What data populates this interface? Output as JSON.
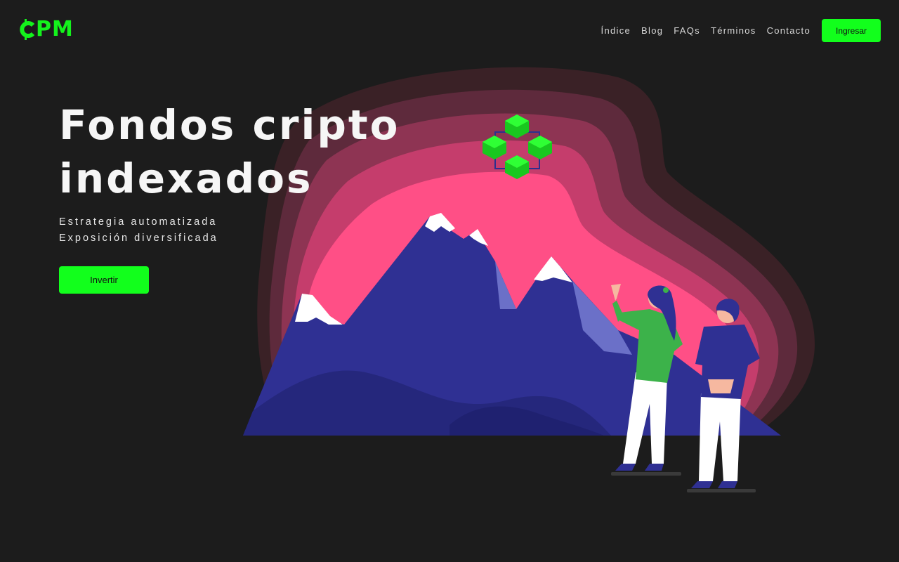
{
  "brand": {
    "logo_text": "CPM",
    "accent_color": "#12ff1c"
  },
  "nav": {
    "links": [
      "Índice",
      "Blog",
      "FAQs",
      "Términos",
      "Contacto"
    ],
    "login_label": "Ingresar"
  },
  "hero": {
    "title_line1": "Fondos cripto",
    "title_line2": "indexados",
    "subtitle_line1": "Estrategia automatizada",
    "subtitle_line2": "Exposición diversificada",
    "cta_label": "Invertir"
  },
  "illustration": {
    "description_icons": [
      "glow-blob",
      "mountains",
      "blockchain-cubes",
      "woman-pointing",
      "man-standing"
    ],
    "glow_colors": [
      "#3a2126",
      "#5e2a3c",
      "#8e3453",
      "#c53d6c",
      "#ff4f86"
    ],
    "mountain_colors": [
      "#2f3093",
      "#25277c",
      "#6b70c8"
    ]
  }
}
